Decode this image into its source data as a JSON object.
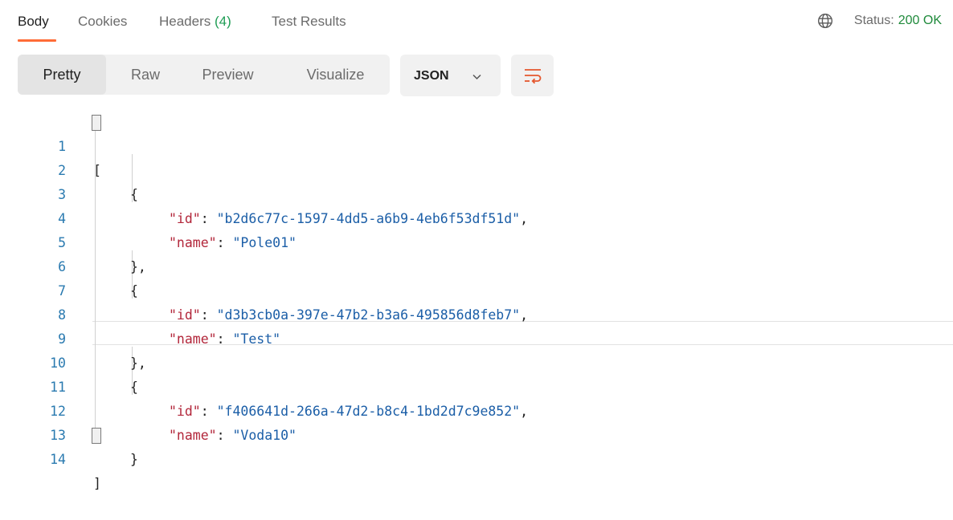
{
  "tabs": {
    "body": "Body",
    "cookies": "Cookies",
    "headers": "Headers",
    "headers_count": "(4)",
    "test_results": "Test Results"
  },
  "status": {
    "label": "Status:",
    "value": "200 OK",
    "globe_icon": "globe-icon"
  },
  "view_modes": {
    "pretty": "Pretty",
    "raw": "Raw",
    "preview": "Preview",
    "visualize": "Visualize",
    "selected": "Pretty"
  },
  "format_select": {
    "value": "JSON",
    "icon": "chevron-down-icon"
  },
  "wrap_button": {
    "icon": "wrap-lines-icon"
  },
  "colors": {
    "accent": "#ff6c37",
    "status_ok": "#1f8a3b",
    "json_key": "#b2263a",
    "json_string": "#1b5ea7",
    "line_number": "#2a7ab0"
  },
  "editor": {
    "lines": [
      {
        "n": "1",
        "text": "["
      },
      {
        "n": "2",
        "text": "{"
      },
      {
        "n": "3",
        "key": "\"id\"",
        "value": "\"b2d6c77c-1597-4dd5-a6b9-4eb6f53df51d\"",
        "trail": ","
      },
      {
        "n": "4",
        "key": "\"name\"",
        "value": "\"Pole01\"",
        "trail": ""
      },
      {
        "n": "5",
        "text": "},"
      },
      {
        "n": "6",
        "text": "{"
      },
      {
        "n": "7",
        "key": "\"id\"",
        "value": "\"d3b3cb0a-397e-47b2-b3a6-495856d8feb7\"",
        "trail": ","
      },
      {
        "n": "8",
        "key": "\"name\"",
        "value": "\"Test\"",
        "trail": ""
      },
      {
        "n": "9",
        "text": "},"
      },
      {
        "n": "10",
        "text": "{"
      },
      {
        "n": "11",
        "key": "\"id\"",
        "value": "\"f406641d-266a-47d2-b8c4-1bd2d7c9e852\"",
        "trail": ","
      },
      {
        "n": "12",
        "key": "\"name\"",
        "value": "\"Voda10\"",
        "trail": ""
      },
      {
        "n": "13",
        "text": "}"
      },
      {
        "n": "14",
        "text": "]"
      }
    ]
  }
}
